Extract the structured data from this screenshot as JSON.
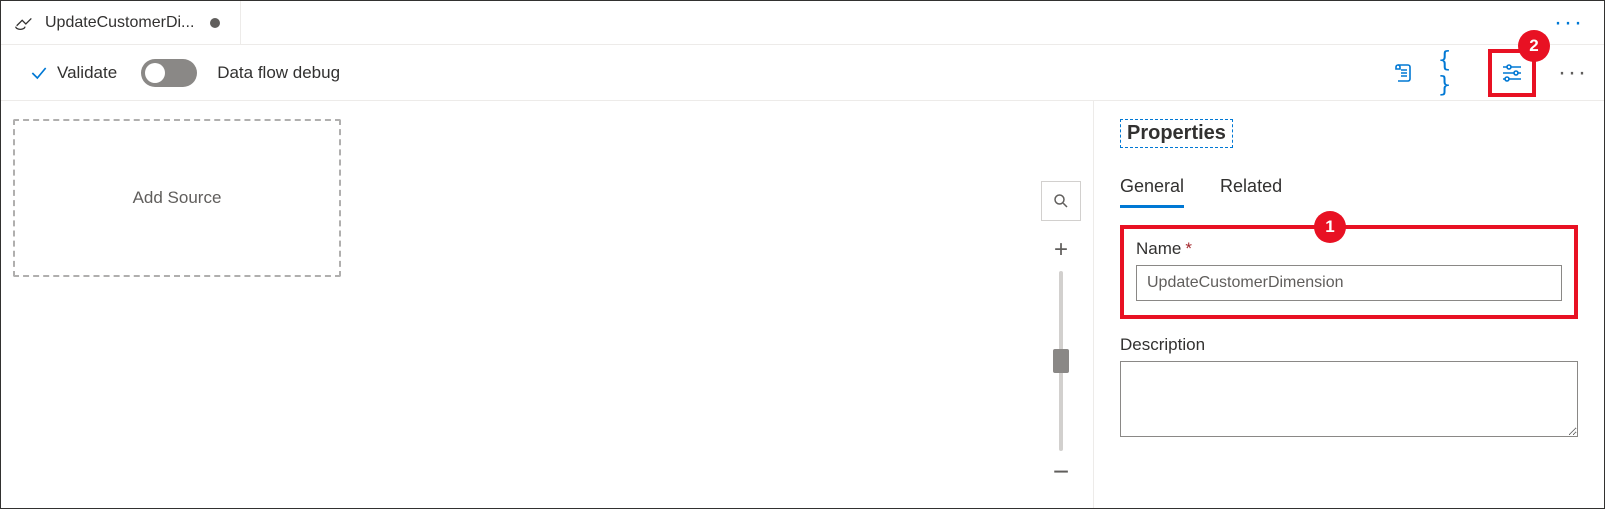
{
  "tab": {
    "title": "UpdateCustomerDi..."
  },
  "toolbar": {
    "validate_label": "Validate",
    "debug_label": "Data flow debug"
  },
  "canvas": {
    "add_source_label": "Add Source"
  },
  "panel": {
    "title": "Properties",
    "tabs": {
      "general": "General",
      "related": "Related"
    },
    "name_label": "Name",
    "name_value": "UpdateCustomerDimension",
    "description_label": "Description",
    "description_value": ""
  },
  "callouts": {
    "one": "1",
    "two": "2"
  }
}
